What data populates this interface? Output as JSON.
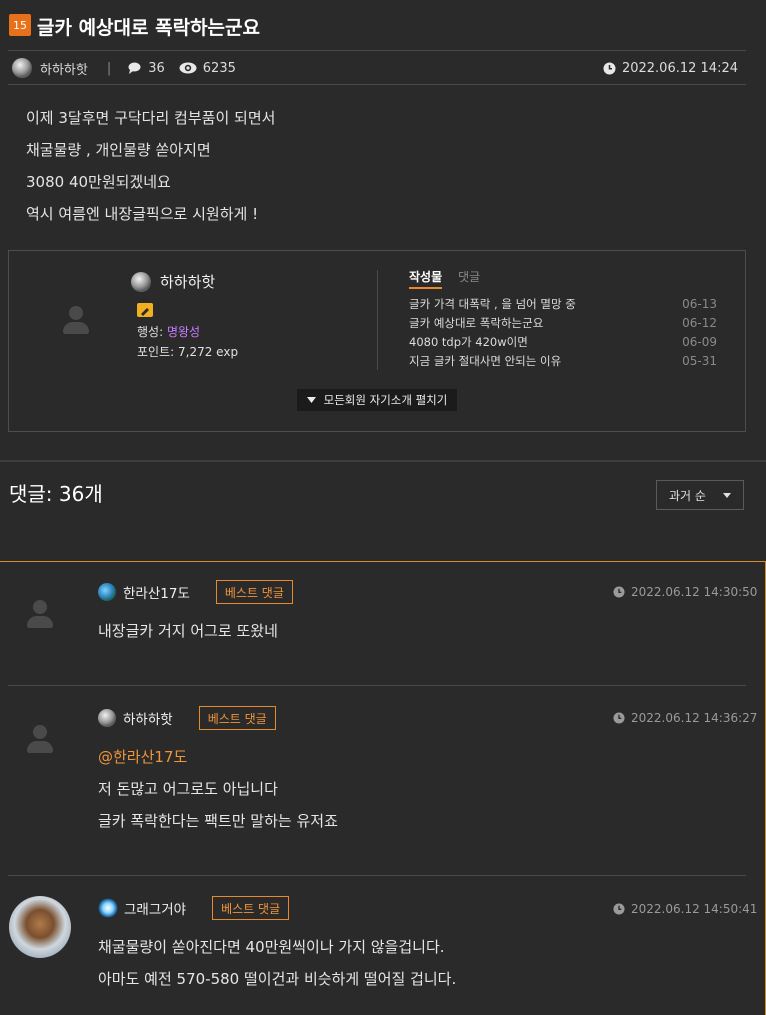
{
  "post": {
    "badge": "15",
    "title": "글카 예상대로 폭락하는군요",
    "author": "하하하핫",
    "comment_count": "36",
    "view_count": "6235",
    "datetime": "2022.06.12 14:24",
    "body": [
      "이제 3달후면 구닥다리 컴부품이 되면서",
      "채굴물량 , 개인물량 쏟아지면",
      "3080 40만원되겠네요",
      "역시 여름엔 내장글픽으로 시원하게 !"
    ]
  },
  "profile": {
    "name": "하하하핫",
    "planet_label": "행성:",
    "planet_value": "명왕성",
    "points_label": "포인트:",
    "points_value": "7,272 exp",
    "tab_posts": "작성물",
    "tab_comments": "댓글",
    "recent": [
      {
        "title": "글카 가격 대폭락 , 을 넘어 멸망 중",
        "date": "06-13"
      },
      {
        "title": "글카 예상대로 폭락하는군요",
        "date": "06-12"
      },
      {
        "title": "4080 tdp가 420w이면",
        "date": "06-09"
      },
      {
        "title": "지금 글카 절대사면 안되는 이유",
        "date": "05-31"
      }
    ],
    "expand_label": "모든회원 자기소개 펼치기"
  },
  "comments_header": {
    "title": "댓글: 36개",
    "sort_label": "과거 순"
  },
  "comments": [
    {
      "name": "한라산17도",
      "badge": "베스트 댓글",
      "time": "2022.06.12 14:30:50",
      "mention": "",
      "lines": [
        "내장글카 거지 어그로 또왔네"
      ]
    },
    {
      "name": "하하하핫",
      "badge": "베스트 댓글",
      "time": "2022.06.12 14:36:27",
      "mention": "@한라산17도",
      "lines": [
        "저 돈많고 어그로도 아닙니다",
        "글카 폭락한다는 팩트만 말하는 유저죠"
      ]
    },
    {
      "name": "그래그거야",
      "badge": "베스트 댓글",
      "time": "2022.06.12 14:50:41",
      "mention": "",
      "lines": [
        "채굴물량이 쏟아진다면 40만원씩이나 가지 않을겁니다.",
        "아마도 예전 570-580 떨이건과 비슷하게 떨어질 겁니다."
      ]
    }
  ],
  "colors": {
    "accent": "#e8892e",
    "planet": "#c77dff",
    "badge_bg": "#e8701a"
  }
}
